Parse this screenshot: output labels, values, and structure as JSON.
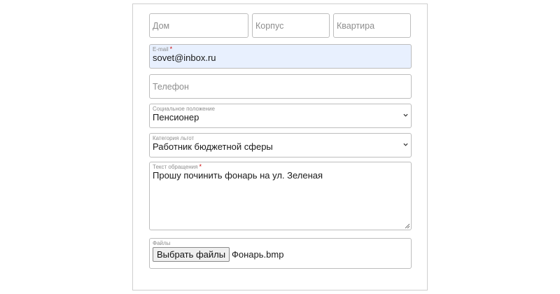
{
  "address": {
    "house_placeholder": "Дом",
    "building_placeholder": "Корпус",
    "apartment_placeholder": "Квартира"
  },
  "email": {
    "label": "E-mail",
    "required_mark": "*",
    "value": "sovet@inbox.ru"
  },
  "phone": {
    "placeholder": "Телефон"
  },
  "social_status": {
    "label": "Социальное положение",
    "value": "Пенсионер"
  },
  "benefit_category": {
    "label": "Категория льгот",
    "value": "Работник бюджетной сферы"
  },
  "message": {
    "label": "Текст обращения",
    "required_mark": "*",
    "value": "Прошу починить фонарь на ул. Зеленая"
  },
  "files": {
    "label": "Файлы",
    "button_label": "Выбрать файлы",
    "file_name": "Фонарь.bmp"
  },
  "colors": {
    "autofill_background": "#e8f0fe",
    "required_mark": "#cc0000",
    "field_border": "#bdbdbd"
  },
  "icons": {
    "select_arrow": "chevron-down-icon",
    "textarea_resize": "resize-handle-icon"
  }
}
